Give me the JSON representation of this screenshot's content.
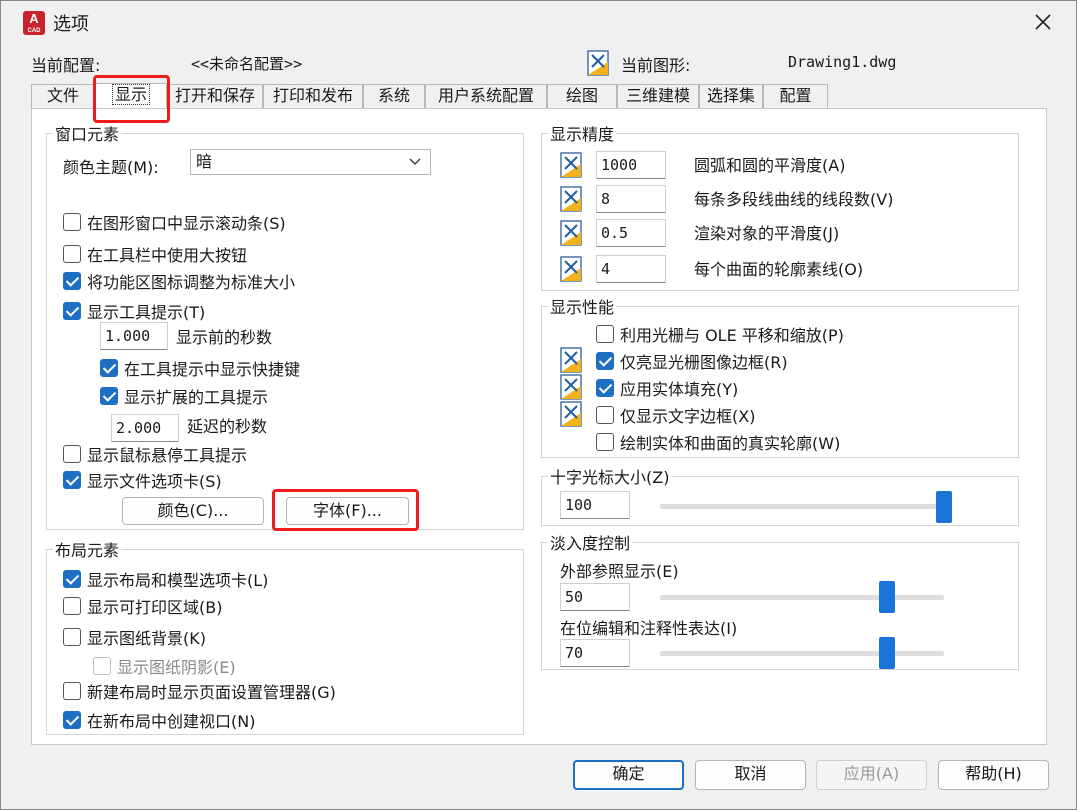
{
  "window": {
    "title": "选项",
    "app_icon_letter": "A",
    "app_icon_sub": "CAD"
  },
  "header": {
    "current_profile_label": "当前配置:",
    "current_profile_value": "<<未命名配置>>",
    "current_drawing_label": "当前图形:",
    "current_drawing_value": "Drawing1.dwg"
  },
  "tabs": [
    "文件",
    "显示",
    "打开和保存",
    "打印和发布",
    "系统",
    "用户系统配置",
    "绘图",
    "三维建模",
    "选择集",
    "配置"
  ],
  "active_tab": "显示",
  "window_elements": {
    "title": "窗口元素",
    "color_theme_label": "颜色主题(M):",
    "color_theme_value": "暗",
    "show_scrollbars": "在图形窗口中显示滚动条(S)",
    "large_buttons": "在工具栏中使用大按钮",
    "resize_ribbon_icons": "将功能区图标调整为标准大小",
    "show_tooltips": "显示工具提示(T)",
    "tooltip_delay_value": "1.000",
    "tooltip_delay_label": "显示前的秒数",
    "show_shortcut_keys": "在工具提示中显示快捷键",
    "show_extended_tooltips": "显示扩展的工具提示",
    "extended_delay_value": "2.000",
    "extended_delay_label": "延迟的秒数",
    "show_rollover_tooltips": "显示鼠标悬停工具提示",
    "show_file_tabs": "显示文件选项卡(S)",
    "colors_button": "颜色(C)...",
    "fonts_button": "字体(F)..."
  },
  "layout_elements": {
    "title": "布局元素",
    "show_layout_model_tabs": "显示布局和模型选项卡(L)",
    "show_printable_area": "显示可打印区域(B)",
    "show_paper_background": "显示图纸背景(K)",
    "show_paper_shadow": "显示图纸阴影(E)",
    "show_page_setup_manager": "新建布局时显示页面设置管理器(G)",
    "create_viewport": "在新布局中创建视口(N)"
  },
  "display_resolution": {
    "title": "显示精度",
    "arc_circle_smoothness_value": "1000",
    "arc_circle_smoothness_label": "圆弧和圆的平滑度(A)",
    "polyline_segments_value": "8",
    "polyline_segments_label": "每条多段线曲线的线段数(V)",
    "rendered_smoothness_value": "0.5",
    "rendered_smoothness_label": "渲染对象的平滑度(J)",
    "contour_lines_value": "4",
    "contour_lines_label": "每个曲面的轮廓素线(O)"
  },
  "display_performance": {
    "title": "显示性能",
    "pan_zoom_raster_ole": "利用光栅与 OLE 平移和缩放(P)",
    "highlight_raster_frame": "仅亮显光栅图像边框(R)",
    "apply_solid_fill": "应用实体填充(Y)",
    "show_text_boundary": "仅显示文字边框(X)",
    "draw_true_silhouettes": "绘制实体和曲面的真实轮廓(W)"
  },
  "crosshair": {
    "title": "十字光标大小(Z)",
    "value": "100",
    "slider_fraction": 1.0
  },
  "fade_control": {
    "title": "淡入度控制",
    "xref_label": "外部参照显示(E)",
    "xref_value": "50",
    "xref_fraction": 0.8,
    "inplace_label": "在位编辑和注释性表达(I)",
    "inplace_value": "70",
    "inplace_fraction": 0.8
  },
  "footer": {
    "ok": "确定",
    "cancel": "取消",
    "apply": "应用(A)",
    "help": "帮助(H)"
  },
  "colors": {
    "accent": "#1d6fc4",
    "slider": "#1a73d6",
    "highlight_box": "#ee1c1c",
    "icon_red": "#c8232c"
  }
}
